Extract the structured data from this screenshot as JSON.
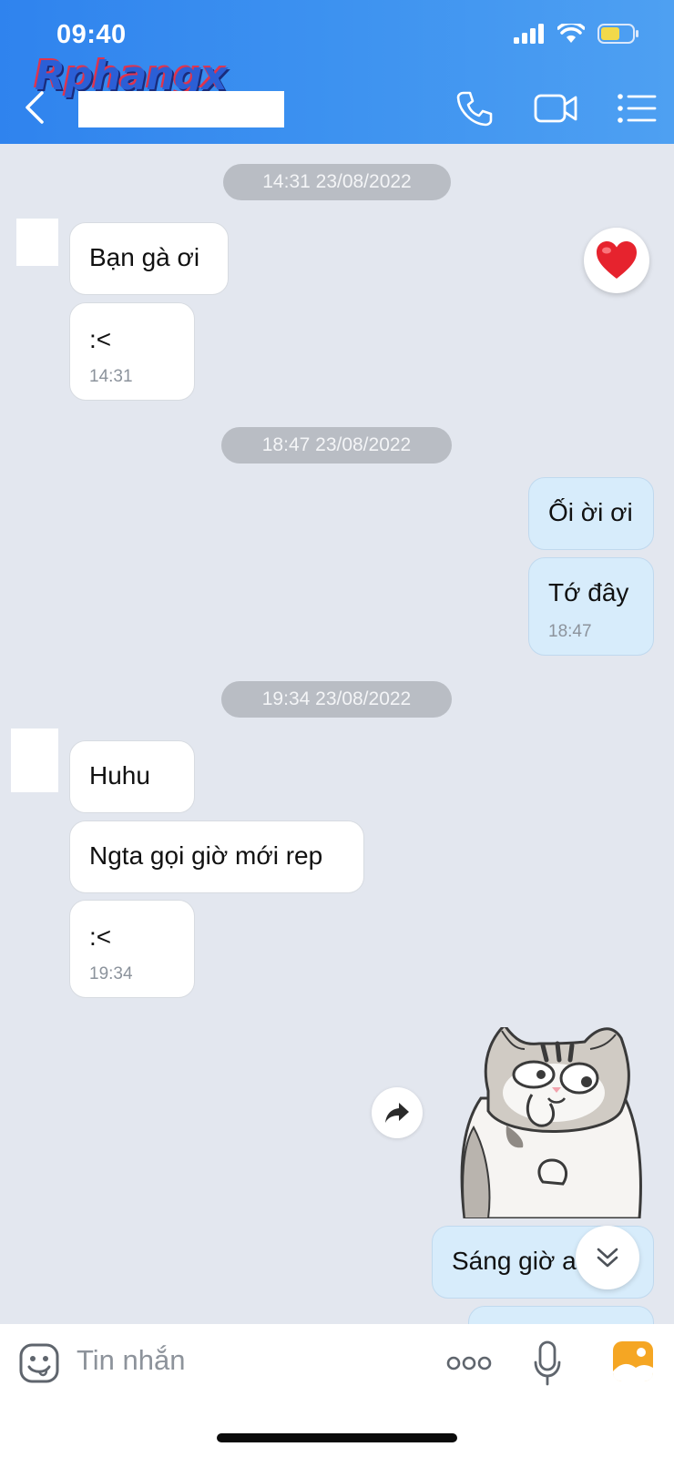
{
  "status_bar": {
    "time": "09:40"
  },
  "header": {
    "watermark": "Rphangx",
    "contact_name": "",
    "icons": [
      "back-icon",
      "phone-icon",
      "video-icon",
      "menu-icon"
    ]
  },
  "chat": {
    "groups": [
      {
        "timestamp": "14:31 23/08/2022",
        "direction": "received",
        "messages": [
          "Bạn gà ơi",
          ":<"
        ],
        "time": "14:31",
        "reaction": "heart"
      },
      {
        "timestamp": "18:47 23/08/2022",
        "direction": "sent",
        "messages": [
          "Ối ời ơi",
          "Tớ đây"
        ],
        "time": "18:47"
      },
      {
        "timestamp": "19:34 23/08/2022",
        "direction": "received",
        "messages": [
          "Huhu",
          "Ngta gọi giờ mới rep",
          ":<"
        ],
        "time": "19:34"
      },
      {
        "direction": "sent",
        "sticker": "cat-sticker",
        "messages": [
          "Sáng giờ a"
        ]
      }
    ]
  },
  "input_bar": {
    "placeholder": "Tin nhắn",
    "icons": [
      "emoji-icon",
      "more-icon",
      "microphone-icon",
      "image-icon"
    ]
  },
  "colors": {
    "header_start": "#2f83ee",
    "header_end": "#4ea0f2",
    "chat_background": "#e3e7ef",
    "sent_bubble": "#d7ecfb",
    "received_bubble": "#ffffff",
    "timestamp_pill": "#b9bdc4",
    "image_icon": "#f5a623"
  }
}
